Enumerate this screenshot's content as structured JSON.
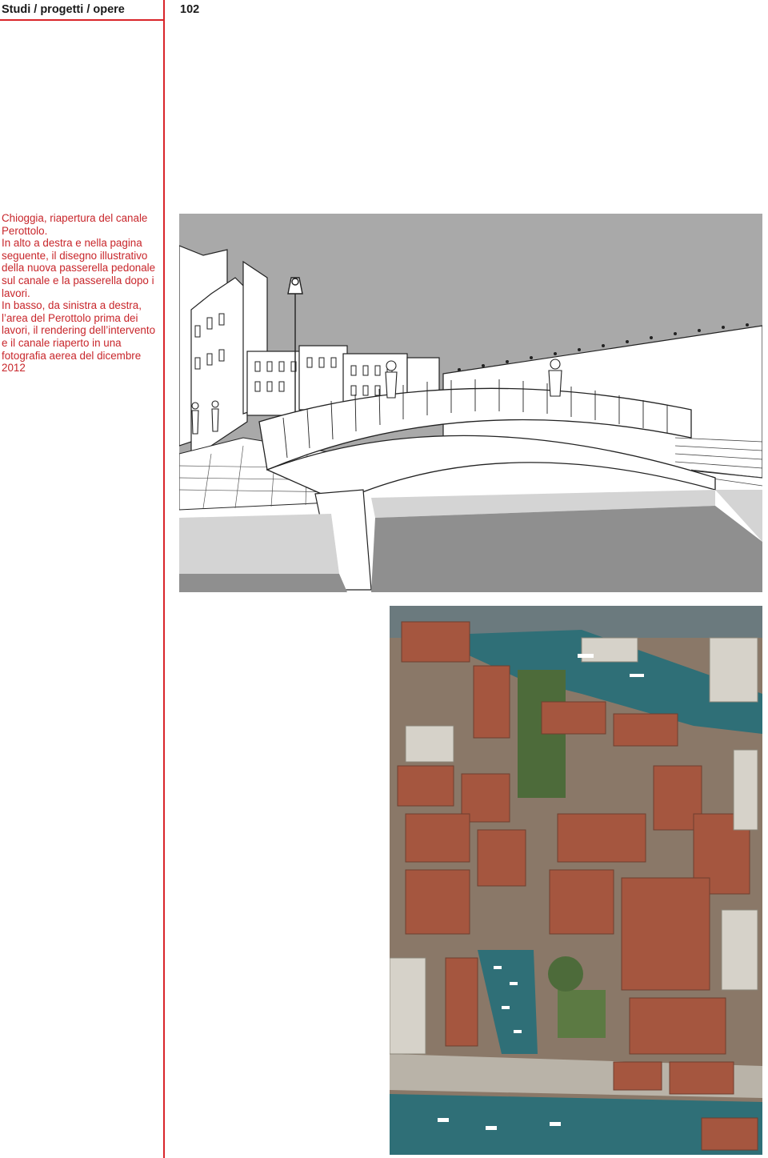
{
  "header": {
    "title": "Studi / progetti / opere",
    "page_number": "102"
  },
  "caption": {
    "title": "Chioggia, riapertura del canale Perottolo.",
    "top_text": "In alto a destra e nella pagina seguente, il disegno illustrativo della nuova passerella pedonale sul canale e la passerella dopo i lavori.",
    "bottom_text": "In basso, da sinistra a destra, l’area del Perottolo prima dei lavori, il rendering dell’intervento e il canale riaperto in una fotografia aerea del dicembre 2012"
  },
  "colors": {
    "accent": "#d9252a",
    "caption_text": "#c8262b",
    "sky_gray": "#a9a9a9",
    "water_light": "#d4d4d4",
    "water_dark": "#8f8f8f",
    "canal_water": "#2f6f77",
    "roof_terracotta": "#a5563f"
  }
}
